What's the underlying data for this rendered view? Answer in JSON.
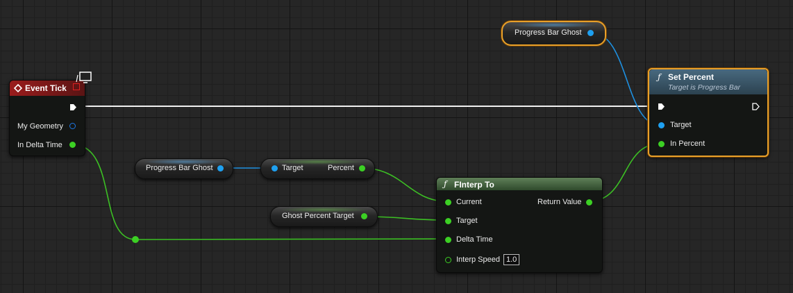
{
  "graph": {
    "event_tick": {
      "title": "Event Tick",
      "pins": {
        "geometry": "My Geometry",
        "delta": "In Delta Time"
      }
    },
    "getter_top": {
      "label": "Progress Bar Ghost"
    },
    "set_percent": {
      "title": "Set Percent",
      "subtitle": "Target is Progress Bar",
      "pins": {
        "target": "Target",
        "in_percent": "In Percent"
      }
    },
    "getter_mid": {
      "label": "Progress Bar Ghost"
    },
    "percent_node": {
      "target": "Target",
      "percent": "Percent"
    },
    "ghost_target": {
      "label": "Ghost Percent Target"
    },
    "finterp": {
      "title": "FInterp To",
      "pins": {
        "current": "Current",
        "target": "Target",
        "delta": "Delta Time",
        "speed": "Interp Speed",
        "speed_value": "1.0",
        "return": "Return Value"
      }
    },
    "colors": {
      "exec": "#ffffff",
      "object": "#1ea0f0",
      "float": "#3cd024",
      "selection": "#e8a02a",
      "event_header": "#8a1a1a",
      "function_header": "#3a5870",
      "pure_header": "#3e6a38"
    }
  }
}
